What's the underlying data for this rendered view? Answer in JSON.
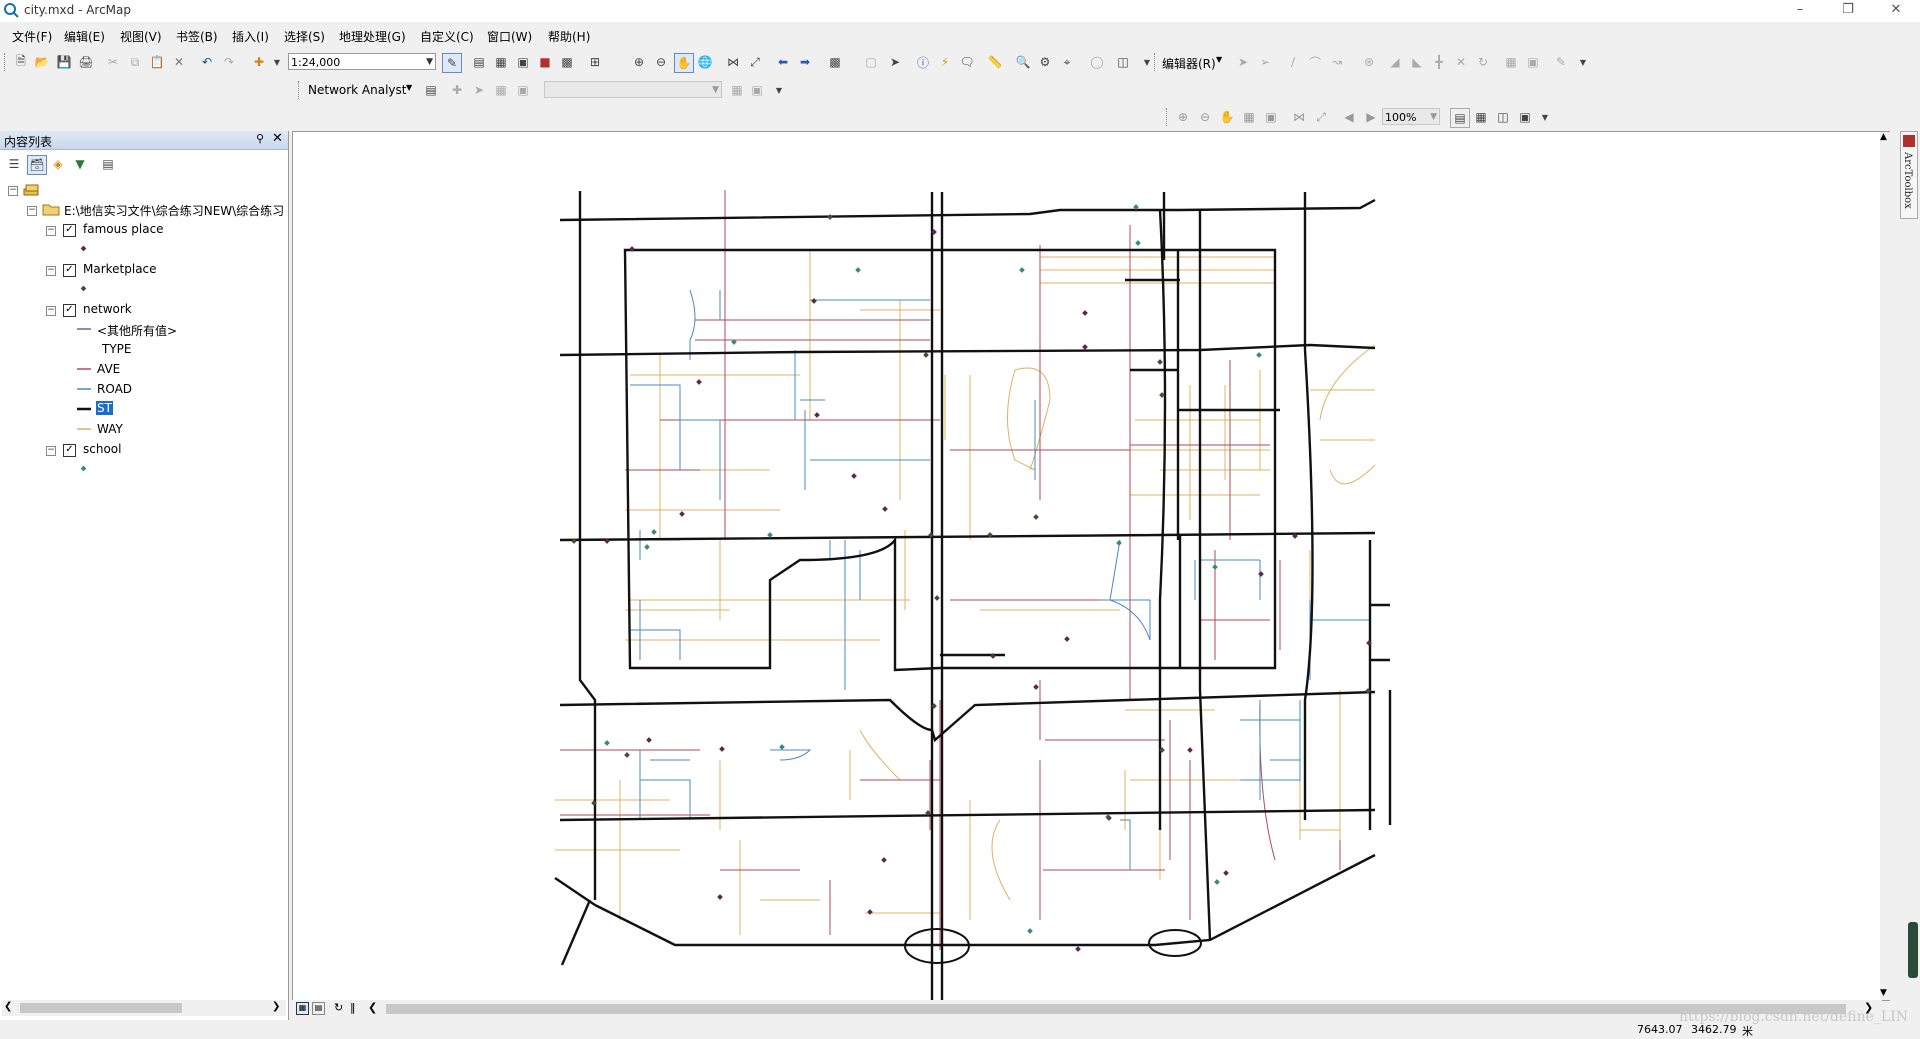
{
  "window": {
    "title": "city.mxd - ArcMap"
  },
  "menu": [
    "文件(F)",
    "编辑(E)",
    "视图(V)",
    "书签(B)",
    "插入(I)",
    "选择(S)",
    "地理处理(G)",
    "自定义(C)",
    "窗口(W)",
    "帮助(H)"
  ],
  "toolbar": {
    "scale_value": "1:24,000",
    "editor_label": "编辑器(R)",
    "network_analyst_label": "Network Analyst",
    "zoom_value": "100%"
  },
  "toc": {
    "title": "内容列表",
    "root_path": "E:\\地信实习文件\\综合练习NEW\\综合练习",
    "layers": {
      "famous_place": "famous place",
      "marketplace": "Marketplace",
      "network": "network",
      "school": "school"
    },
    "network_legend": {
      "other": "<其他所有值>",
      "type_header": "TYPE",
      "ave": "AVE",
      "road": "ROAD",
      "st": "ST",
      "way": "WAY"
    }
  },
  "arctoolbox": {
    "label": "ArcToolbox"
  },
  "status": {
    "x": "7643.07",
    "y": "3462.79",
    "unit": "米"
  },
  "watermark": "https://blog.csdn.net/define_LIN",
  "colors": {
    "ave": "#b04a5a",
    "road": "#4a88c8",
    "way": "#e0b060",
    "st": "#111111",
    "marker_famous": "#5a2a4a",
    "marker_school": "#3a8a7a"
  }
}
